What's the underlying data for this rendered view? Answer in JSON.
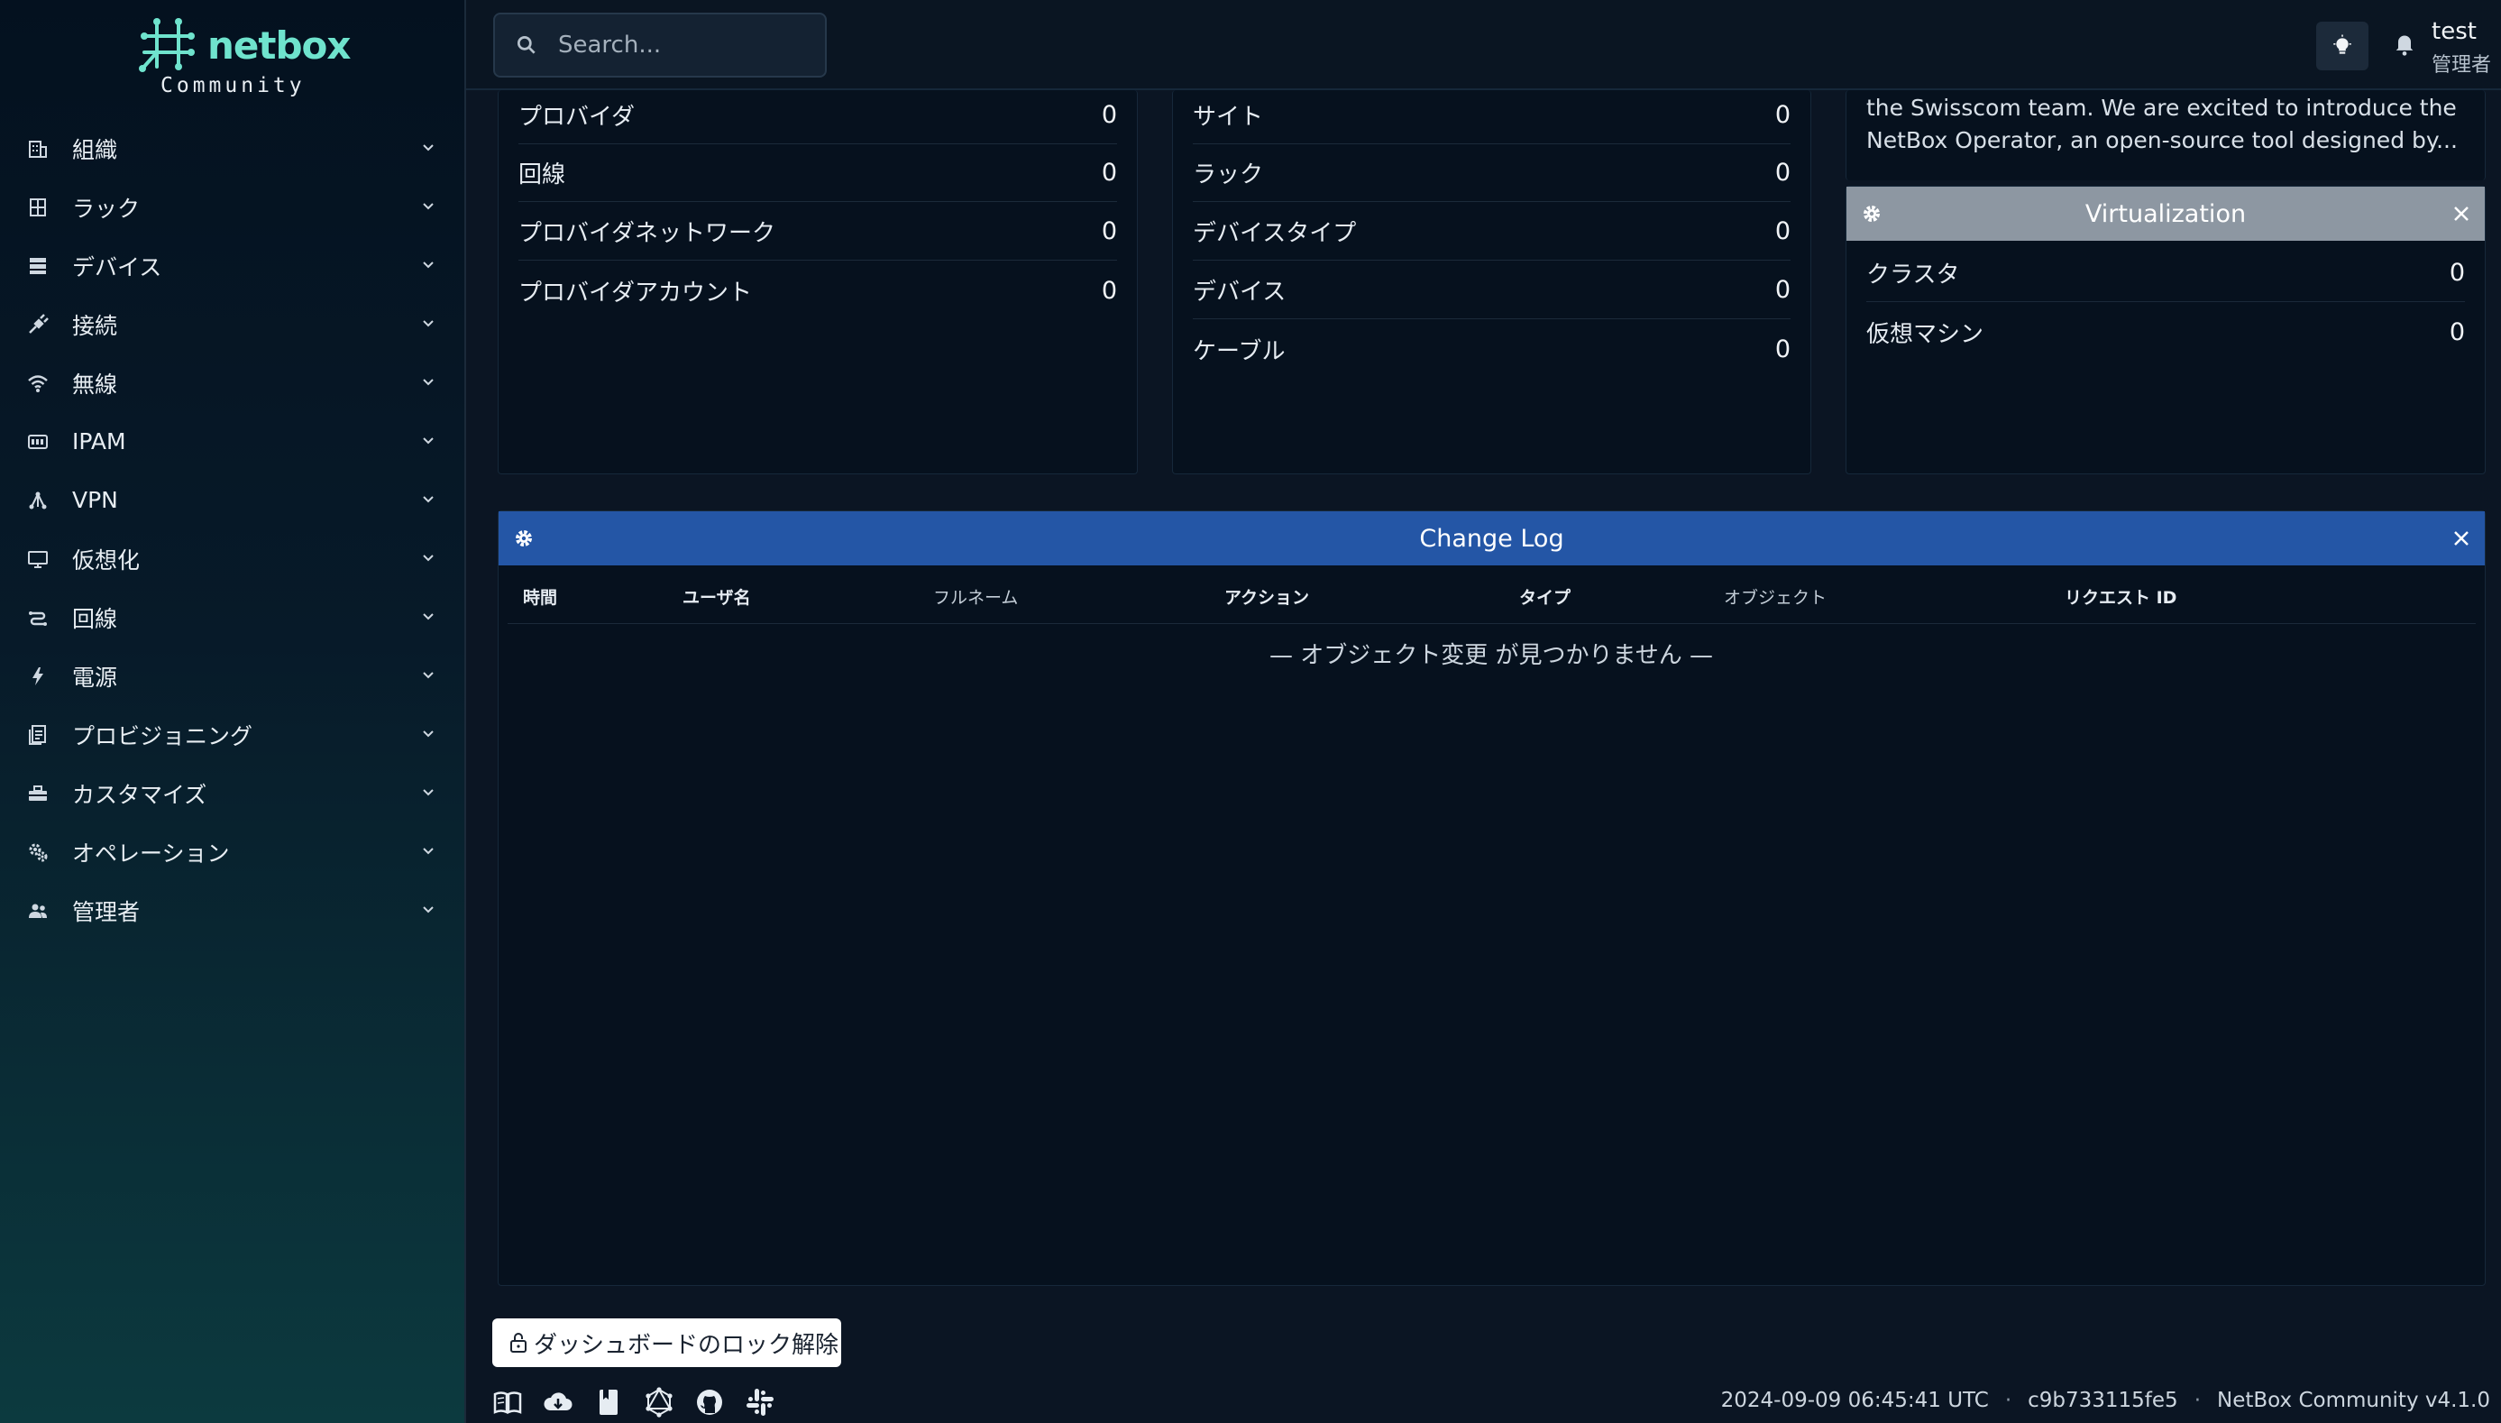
{
  "brand": {
    "name": "netbox",
    "subtitle": "Community"
  },
  "sidebar": {
    "items": [
      {
        "label": "組織"
      },
      {
        "label": "ラック"
      },
      {
        "label": "デバイス"
      },
      {
        "label": "接続"
      },
      {
        "label": "無線"
      },
      {
        "label": "IPAM"
      },
      {
        "label": "VPN"
      },
      {
        "label": "仮想化"
      },
      {
        "label": "回線"
      },
      {
        "label": "電源"
      },
      {
        "label": "プロビジョニング"
      },
      {
        "label": "カスタマイズ"
      },
      {
        "label": "オペレーション"
      },
      {
        "label": "管理者"
      }
    ]
  },
  "topbar": {
    "search_placeholder": "Search...",
    "user_name": "test",
    "user_role": "管理者"
  },
  "circuits_card": {
    "rows": [
      {
        "label": "プロバイダ",
        "value": "0"
      },
      {
        "label": "回線",
        "value": "0"
      },
      {
        "label": "プロバイダネットワーク",
        "value": "0"
      },
      {
        "label": "プロバイダアカウント",
        "value": "0"
      }
    ]
  },
  "dcim_card": {
    "rows": [
      {
        "label": "サイト",
        "value": "0"
      },
      {
        "label": "ラック",
        "value": "0"
      },
      {
        "label": "デバイスタイプ",
        "value": "0"
      },
      {
        "label": "デバイス",
        "value": "0"
      },
      {
        "label": "ケーブル",
        "value": "0"
      }
    ]
  },
  "news": {
    "line1": "the Swisscom team. We are excited to introduce the",
    "line2": "NetBox Operator, an open-source tool designed by..."
  },
  "virtualization_card": {
    "title": "Virtualization",
    "rows": [
      {
        "label": "クラスタ",
        "value": "0"
      },
      {
        "label": "仮想マシン",
        "value": "0"
      }
    ]
  },
  "changelog": {
    "title": "Change Log",
    "columns": [
      "時間",
      "ユーザ名",
      "フルネーム",
      "アクション",
      "タイプ",
      "オブジェクト",
      "リクエスト ID"
    ],
    "empty_message": "— オブジェクト変更 が見つかりません —"
  },
  "footer": {
    "unlock_label": "ダッシュボードのロック解除",
    "timestamp": "2024-09-09 06:45:41 UTC",
    "commit": "c9b733115fe5",
    "version": "NetBox Community v4.1.0",
    "separator": "·"
  },
  "colors": {
    "brand_accent": "#6fe3cd",
    "changelog_header": "#2456a6",
    "virtualization_header": "#8d97a2"
  }
}
